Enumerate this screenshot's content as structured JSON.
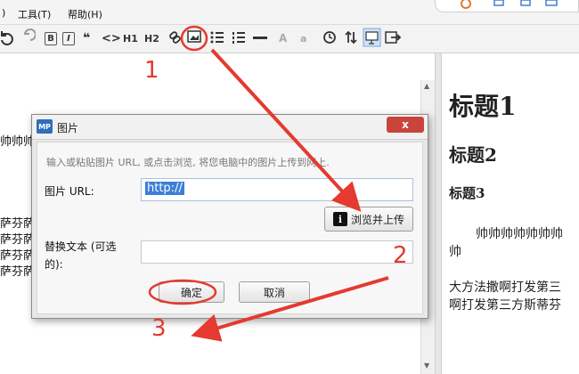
{
  "menubar": {
    "items": [
      ")",
      "工具(T)",
      "帮助(H)"
    ]
  },
  "toolbar": {
    "undo_icon": "undo-icon",
    "redo_icon": "redo-icon",
    "bold": "B",
    "italic": "I",
    "quote": "❝",
    "code": "<>",
    "h1": "H1",
    "h2": "H2",
    "big_a": "A",
    "small_a": "a"
  },
  "editor_left": {
    "lines": [
      "帅帅帅",
      "萨芬萨",
      "萨芬萨",
      "萨芬萨",
      "萨芬萨"
    ]
  },
  "preview": {
    "h1": "标题1",
    "h2": "标题2",
    "h3": "标题3",
    "p1_line1": "帅帅帅帅帅帅帅",
    "p1_line2": "帅",
    "p2_line1": "大方法撒啊打发第三",
    "p2_line2": "啊打发第三方斯蒂芬"
  },
  "dialog": {
    "icon_text": "MP",
    "title": "图片",
    "close_label": "x",
    "hint": "输入或粘贴图片 URL, 或点击浏览, 将您电脑中的图片上传到网上.",
    "url_label": "图片 URL:",
    "url_value": "http://",
    "browse_label": "浏览并上传",
    "alt_label_line1": "替换文本 (可选",
    "alt_label_line2": "的):",
    "alt_value": "",
    "ok_label": "确定",
    "cancel_label": "取消"
  },
  "annotations": {
    "step1": "1",
    "step2": "2",
    "step3": "3"
  },
  "colors": {
    "annotation": "#e53a2f",
    "accent": "#3b7fd8",
    "close": "#c9453b"
  }
}
